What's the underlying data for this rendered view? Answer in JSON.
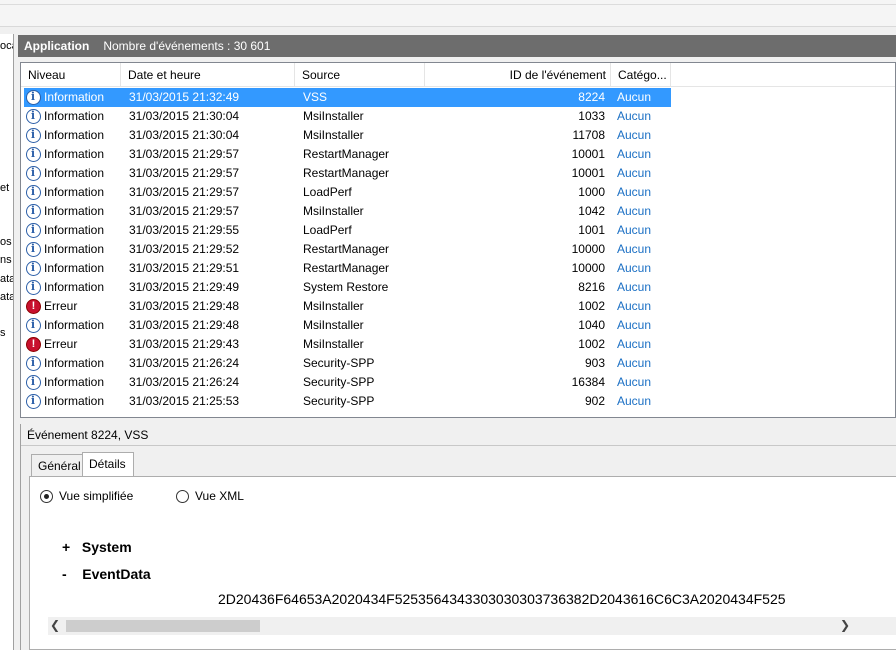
{
  "left_pane": {
    "fragments": [
      "oca",
      "et",
      "os",
      "ns",
      "ata",
      "ata",
      "s"
    ]
  },
  "header": {
    "title": "Application",
    "count_text": "Nombre d'événements : 30 601"
  },
  "columns": [
    "Niveau",
    "Date et heure",
    "Source",
    "ID de l'événement",
    "Catégo..."
  ],
  "events": [
    {
      "level": "Information",
      "icon": "info-icon",
      "date": "31/03/2015 21:32:49",
      "source": "VSS",
      "id": "8224",
      "category": "Aucun"
    },
    {
      "level": "Information",
      "icon": "info-icon",
      "date": "31/03/2015 21:30:04",
      "source": "MsiInstaller",
      "id": "1033",
      "category": "Aucun"
    },
    {
      "level": "Information",
      "icon": "info-icon",
      "date": "31/03/2015 21:30:04",
      "source": "MsiInstaller",
      "id": "11708",
      "category": "Aucun"
    },
    {
      "level": "Information",
      "icon": "info-icon",
      "date": "31/03/2015 21:29:57",
      "source": "RestartManager",
      "id": "10001",
      "category": "Aucun"
    },
    {
      "level": "Information",
      "icon": "info-icon",
      "date": "31/03/2015 21:29:57",
      "source": "RestartManager",
      "id": "10001",
      "category": "Aucun"
    },
    {
      "level": "Information",
      "icon": "info-icon",
      "date": "31/03/2015 21:29:57",
      "source": "LoadPerf",
      "id": "1000",
      "category": "Aucun"
    },
    {
      "level": "Information",
      "icon": "info-icon",
      "date": "31/03/2015 21:29:57",
      "source": "MsiInstaller",
      "id": "1042",
      "category": "Aucun"
    },
    {
      "level": "Information",
      "icon": "info-icon",
      "date": "31/03/2015 21:29:55",
      "source": "LoadPerf",
      "id": "1001",
      "category": "Aucun"
    },
    {
      "level": "Information",
      "icon": "info-icon",
      "date": "31/03/2015 21:29:52",
      "source": "RestartManager",
      "id": "10000",
      "category": "Aucun"
    },
    {
      "level": "Information",
      "icon": "info-icon",
      "date": "31/03/2015 21:29:51",
      "source": "RestartManager",
      "id": "10000",
      "category": "Aucun"
    },
    {
      "level": "Information",
      "icon": "info-icon",
      "date": "31/03/2015 21:29:49",
      "source": "System Restore",
      "id": "8216",
      "category": "Aucun"
    },
    {
      "level": "Erreur",
      "icon": "error-icon",
      "date": "31/03/2015 21:29:48",
      "source": "MsiInstaller",
      "id": "1002",
      "category": "Aucun"
    },
    {
      "level": "Information",
      "icon": "info-icon",
      "date": "31/03/2015 21:29:48",
      "source": "MsiInstaller",
      "id": "1040",
      "category": "Aucun"
    },
    {
      "level": "Erreur",
      "icon": "error-icon",
      "date": "31/03/2015 21:29:43",
      "source": "MsiInstaller",
      "id": "1002",
      "category": "Aucun"
    },
    {
      "level": "Information",
      "icon": "info-icon",
      "date": "31/03/2015 21:26:24",
      "source": "Security-SPP",
      "id": "903",
      "category": "Aucun"
    },
    {
      "level": "Information",
      "icon": "info-icon",
      "date": "31/03/2015 21:26:24",
      "source": "Security-SPP",
      "id": "16384",
      "category": "Aucun"
    },
    {
      "level": "Information",
      "icon": "info-icon",
      "date": "31/03/2015 21:25:53",
      "source": "Security-SPP",
      "id": "902",
      "category": "Aucun"
    }
  ],
  "selected_index": 0,
  "detail": {
    "title": "Événement 8224, VSS",
    "tabs": [
      "Général",
      "Détails"
    ],
    "active_tab": "Détails",
    "view_simple": "Vue simplifiée",
    "view_xml": "Vue XML",
    "selected_view": "Vue simplifiée",
    "tree": [
      {
        "toggle": "+",
        "label": "System"
      },
      {
        "toggle": "-",
        "label": "EventData"
      }
    ],
    "hex_data": "2D20436F64653A2020434F5253564343303030303736382D2043616C6C3A2020434F525"
  }
}
